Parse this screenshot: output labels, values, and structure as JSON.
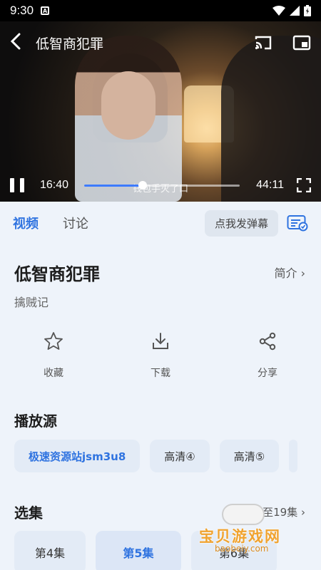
{
  "status_bar": {
    "time": "9:30",
    "badge": "A"
  },
  "player": {
    "title": "低智商犯罪",
    "subtitle_text": "钱包手灭了口",
    "current_time": "16:40",
    "duration": "44:11",
    "progress": 0.377
  },
  "tabs": [
    {
      "label": "视频",
      "active": true
    },
    {
      "label": "讨论",
      "active": false
    }
  ],
  "danmu_button": "点我发弹幕",
  "show": {
    "title": "低智商犯罪",
    "intro_link": "简介 ›",
    "episode_name": "擒贼记"
  },
  "actions": [
    {
      "label": "收藏",
      "icon": "star-icon"
    },
    {
      "label": "下载",
      "icon": "download-icon"
    },
    {
      "label": "分享",
      "icon": "share-icon"
    }
  ],
  "sources_section": {
    "title": "播放源",
    "items": [
      {
        "label": "极速资源站jsm3u8",
        "active": true
      },
      {
        "label": "高清④",
        "active": false
      },
      {
        "label": "高清⑤",
        "active": false
      }
    ]
  },
  "episodes_section": {
    "title": "选集",
    "more": "更多至19集 ›",
    "items": [
      {
        "label": "第4集",
        "active": false
      },
      {
        "label": "第5集",
        "active": true
      },
      {
        "label": "第6集",
        "active": false
      }
    ]
  },
  "watermark": {
    "text": "宝贝游戏网",
    "url": "baobeiy.com"
  },
  "colors": {
    "accent": "#2f73e0",
    "background": "#eef3fa",
    "chip": "#e3ebf6"
  }
}
